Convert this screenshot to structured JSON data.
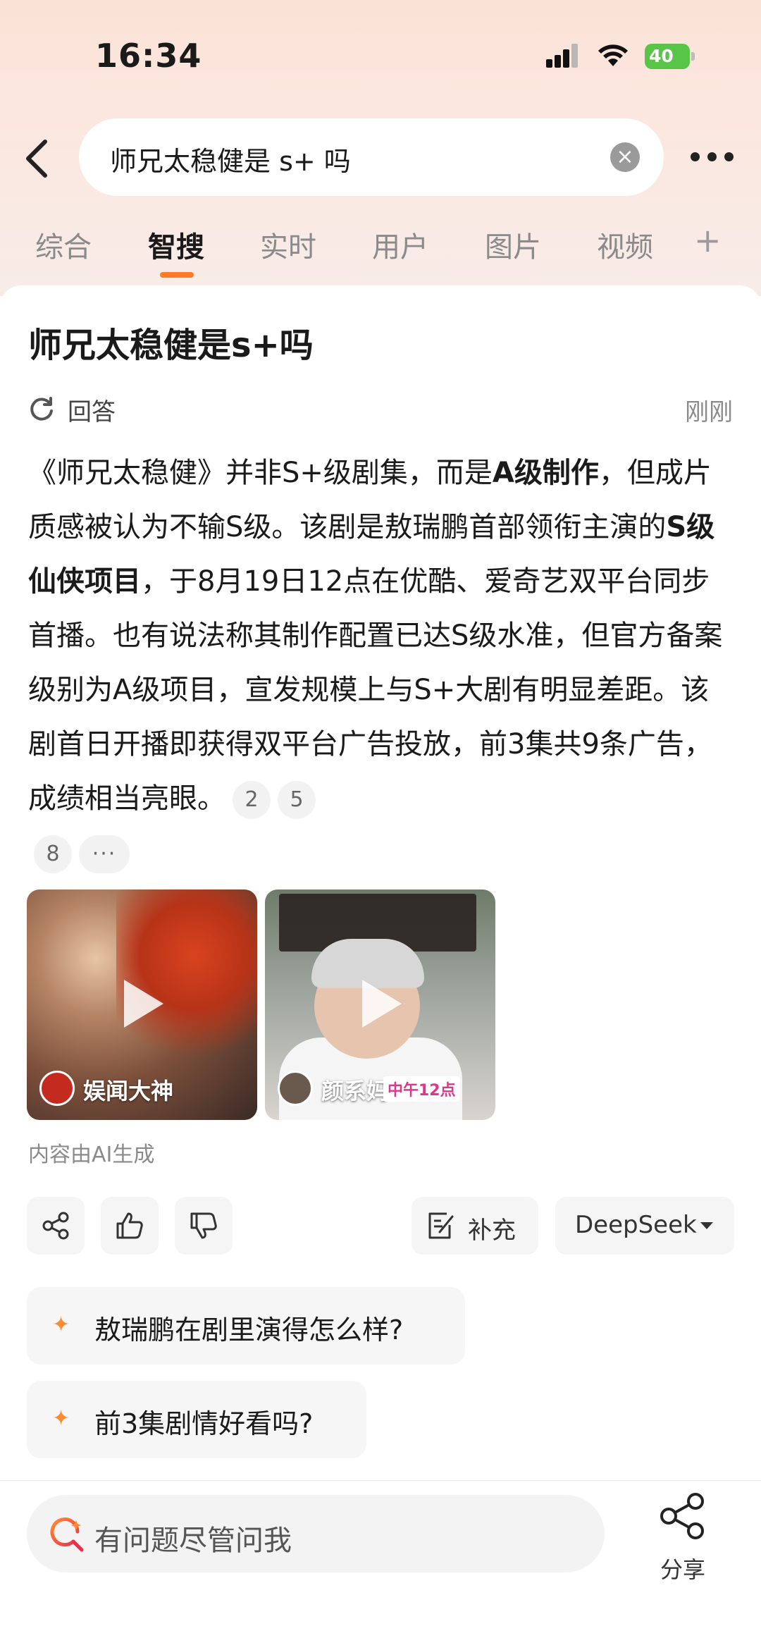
{
  "status_bar": {
    "time": "16:34",
    "battery": "40"
  },
  "search": {
    "query": "师兄太稳健是 s+ 吗"
  },
  "tabs": [
    {
      "label": "综合"
    },
    {
      "label": "智搜"
    },
    {
      "label": "实时"
    },
    {
      "label": "用户"
    },
    {
      "label": "图片"
    },
    {
      "label": "视频"
    }
  ],
  "tab_plus": "+",
  "answer": {
    "title": "师兄太稳健是s+吗",
    "meta_label": "回答",
    "meta_time": "刚刚",
    "body_p1": "《师兄太稳健》并非S+级剧集，而是",
    "body_b1": "A级制作",
    "body_p2": "，但成片质感被认为不输S级。该剧是敖瑞鹏首部领衔主演的",
    "body_b2": "S级仙侠项目",
    "body_p3": "，于8月19日12点在优酷、爱奇艺双平台同步首播。也有说法称其制作配置已达S级水准，但官方备案级别为A级项目，宣发规模上与S+大剧有明显差距。该剧首日开播即获得双平台广告投放，前3集共9条广告，成绩相当亮眼。",
    "citations": [
      "2",
      "5",
      "8"
    ],
    "citation_more": "···"
  },
  "videos": [
    {
      "author": "娱闻大神"
    },
    {
      "author": "颜系妈",
      "badge": "中午12点"
    }
  ],
  "ai_note": "内容由AI生成",
  "actions": {
    "supplement_label": "补充",
    "model_label": "DeepSeek"
  },
  "suggestions": [
    {
      "text": "敖瑞鹏在剧里演得怎么样?"
    },
    {
      "text": "前3集剧情好看吗?"
    }
  ],
  "bottom": {
    "ask_placeholder": "有问题尽管问我",
    "share_label": "分享"
  }
}
